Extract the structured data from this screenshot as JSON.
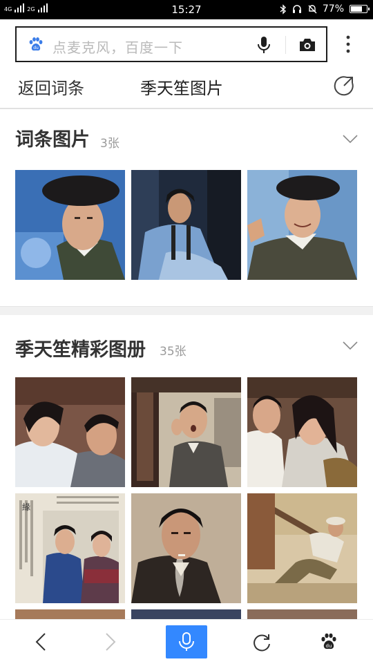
{
  "status_bar": {
    "network_1": "4G",
    "network_2": "2G",
    "time": "15:27",
    "battery": "77%",
    "battery_level": 0.77
  },
  "search": {
    "placeholder": "点麦克风，百度一下"
  },
  "nav": {
    "back_label": "返回词条",
    "title": "季天笙图片"
  },
  "sections": [
    {
      "title": "词条图片",
      "count": "3张",
      "images": [
        {
          "icon": "photo-man-beret-close"
        },
        {
          "icon": "photo-man-denim-seated"
        },
        {
          "icon": "photo-man-beret-smiling"
        }
      ]
    },
    {
      "title": "季天笙精彩图册",
      "count": "35张",
      "images": [
        {
          "icon": "photo-couple-embrace"
        },
        {
          "icon": "photo-man-shocked-interior"
        },
        {
          "icon": "photo-couple-crying"
        },
        {
          "icon": "photo-magazine-scan"
        },
        {
          "icon": "photo-man-smoking"
        },
        {
          "icon": "photo-man-falling-street"
        }
      ]
    }
  ],
  "toolbar": {
    "items": [
      "back-icon",
      "forward-icon",
      "microphone-icon",
      "refresh-icon",
      "baidu-paw-icon"
    ]
  },
  "colors": {
    "accent": "#3388ff",
    "paw": "#3b7de8",
    "text": "#333333",
    "muted": "#9a9a9a"
  }
}
